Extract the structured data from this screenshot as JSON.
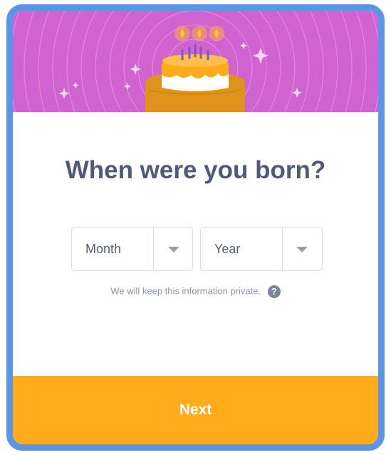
{
  "dialog": {
    "title": "When were you born?",
    "month_select": {
      "label": "Month"
    },
    "year_select": {
      "label": "Year"
    },
    "privacy_text": "We will keep this information private.",
    "help_icon_glyph": "?",
    "next_label": "Next"
  },
  "colors": {
    "frame": "#5b95e8",
    "banner": "#cf63cf",
    "cake": "#ffab1a",
    "title": "#4d5b77",
    "next_button": "#ffab1a"
  },
  "icons": {
    "banner": "birthday-cake-illustration",
    "select_caret": "chevron-down-icon",
    "help": "question-mark-icon"
  }
}
